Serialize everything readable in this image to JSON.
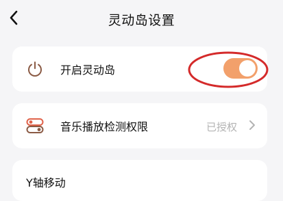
{
  "header": {
    "title": "灵动岛设置",
    "back_icon": "chevron-left-icon"
  },
  "settings": {
    "enable_island": {
      "icon": "power-icon",
      "label": "开启灵动岛",
      "toggle_on": true,
      "toggle_color": "#f2a06b"
    },
    "music_permission": {
      "icon": "toggle-switches-icon",
      "label": "音乐播放检测权限",
      "status": "已授权",
      "chevron_icon": "chevron-right-icon"
    },
    "y_axis": {
      "label": "Y轴移动"
    }
  },
  "annotation": {
    "color": "#d42a2a",
    "shape": "ellipse-around-toggle"
  },
  "colors": {
    "accent": "#f2a06b",
    "background": "#f5f5f7",
    "card": "#ffffff",
    "muted_text": "#b3b3b3"
  }
}
